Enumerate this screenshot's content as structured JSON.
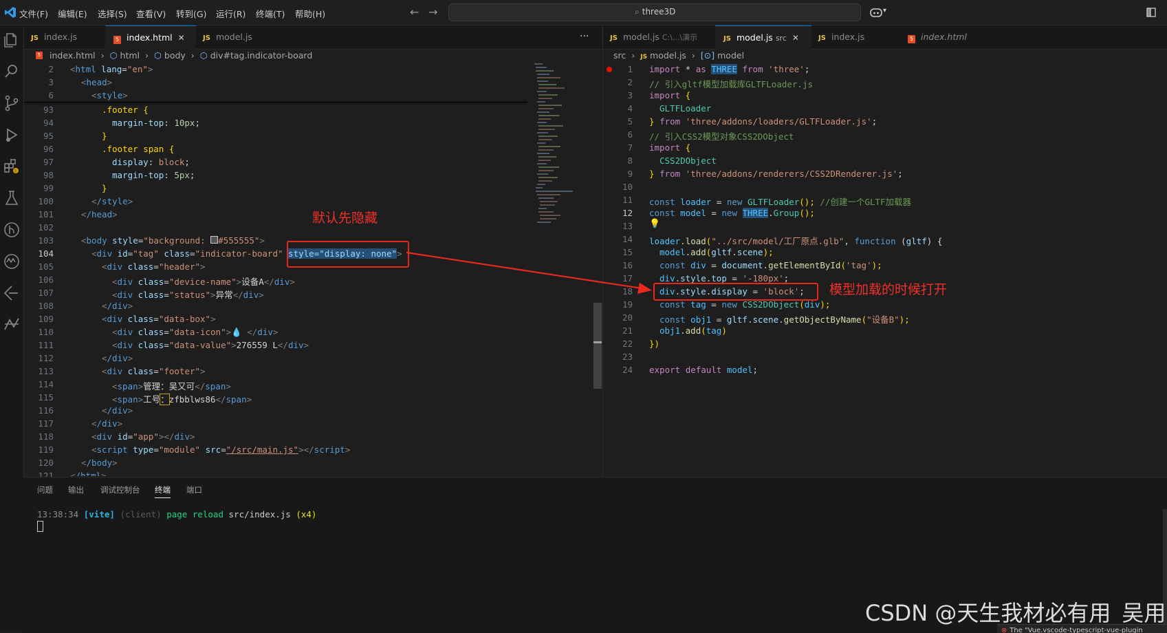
{
  "titlebar": {
    "menus": [
      "文件(F)",
      "编辑(E)",
      "选择(S)",
      "查看(V)",
      "转到(G)",
      "运行(R)",
      "终端(T)",
      "帮助(H)"
    ],
    "search": "three3D"
  },
  "activity_icons": [
    "explorer-icon",
    "search-icon",
    "source-control-icon",
    "run-debug-icon",
    "extensions-icon",
    "testing-icon",
    "git-lens-icon",
    "ai-assistant-icon",
    "remote-icon",
    "git-graph-icon"
  ],
  "left_tabs": [
    {
      "label": "index.js",
      "type": "js"
    },
    {
      "label": "index.html",
      "type": "html"
    },
    {
      "label": "model.js",
      "type": "js"
    }
  ],
  "right_tabs": [
    {
      "label": "model.js",
      "type": "js",
      "hint": "C:\\...\\演示"
    },
    {
      "label": "model.js",
      "type": "js",
      "hint": "src"
    },
    {
      "label": "index.js",
      "type": "js"
    },
    {
      "label": "index.html",
      "type": "html"
    }
  ],
  "left_breadcrumb": [
    "index.html",
    "html",
    "body",
    "div#tag.indicator-board"
  ],
  "right_breadcrumb": [
    "src",
    "model.js",
    "model"
  ],
  "left_editor": {
    "line_numbers": [
      "2",
      "3",
      "6",
      "93",
      "94",
      "95",
      "96",
      "97",
      "98",
      "99",
      "100",
      "101",
      "102",
      "103",
      "104",
      "105",
      "106",
      "107",
      "108",
      "109",
      "110",
      "111",
      "112",
      "113",
      "114",
      "115",
      "116",
      "117",
      "118",
      "119",
      "120",
      "121"
    ],
    "current_line": "104",
    "lines": {
      "l2_tag": "html",
      "l2_attr": "lang",
      "l2_val": "\"en\"",
      "l3_tag": "head",
      "l6_tag": "style",
      "l93": ".footer {",
      "l94_prop": "margin-top",
      "l94_val": "10px",
      "l95": "}",
      "l96": ".footer span {",
      "l97_prop": "display",
      "l97_val": "block",
      "l98_prop": "margin-top",
      "l98_val": "5px",
      "l99": "}",
      "l100_tag": "/style",
      "l101_tag": "/head",
      "l103_tag": "body",
      "l103_attr": "style",
      "l103_val": "\"background:",
      "l103_color": "#555555\"",
      "l104_tag": "div",
      "l104_a1": "id",
      "l104_v1": "\"tag\"",
      "l104_a2": "class",
      "l104_v2": "\"indicator-board\"",
      "l104_sel": "style=\"display: none\"",
      "l105_tag": "div",
      "l105_attr": "class",
      "l105_val": "\"header\"",
      "l106_val": "\"device-name\"",
      "l106_text": "设备A",
      "l107_val": "\"status\"",
      "l107_text": "异常",
      "l108_tag": "/div",
      "l109_val": "\"data-box\"",
      "l110_val": "\"data-icon\"",
      "l110_text": "💧 ",
      "l111_val": "\"data-value\"",
      "l111_text": "276559 L",
      "l112_tag": "/div",
      "l113_val": "\"footer\"",
      "l114_text": "管理：吴又可",
      "l115_text_a": "工号",
      "l115_text_b": "：",
      "l115_text_c": "zfbblws86",
      "l116_tag": "/div",
      "l117_tag": "/div",
      "l118_attr": "id",
      "l118_val": "\"app\"",
      "l119_a1": "type",
      "l119_v1": "\"module\"",
      "l119_a2": "src",
      "l119_v2": "\"/src/main.js\"",
      "l120_tag": "/body",
      "l121_tag": "/html"
    }
  },
  "right_editor": {
    "line_numbers": [
      "1",
      "2",
      "3",
      "4",
      "5",
      "6",
      "7",
      "8",
      "9",
      "10",
      "11",
      "12",
      "13",
      "14",
      "15",
      "16",
      "17",
      "18",
      "19",
      "20",
      "21",
      "22",
      "23",
      "24"
    ],
    "current_line": "12",
    "lines": {
      "r1": [
        "import",
        " * ",
        "as",
        " ",
        "THREE",
        " ",
        "from",
        " ",
        "'three'",
        ";"
      ],
      "r2": "// 引入gltf模型加载库GLTFLoader.js",
      "r3": [
        "import",
        " {"
      ],
      "r4": "GLTFLoader",
      "r5": [
        "} ",
        "from",
        " ",
        "'three/addons/loaders/GLTFLoader.js'",
        ";"
      ],
      "r6": "// 引入CSS2模型对象CSS2DObject",
      "r7": [
        "import",
        " {"
      ],
      "r8": "CSS2DObject",
      "r9": [
        "} ",
        "from",
        " ",
        "'three/addons/renderers/CSS2DRenderer.js'",
        ";"
      ],
      "r11": [
        "const",
        " ",
        "loader",
        " = ",
        "new",
        " ",
        "GLTFLoader",
        "(); ",
        "//创建一个GLTF加载器"
      ],
      "r12": [
        "const",
        " ",
        "model",
        " = ",
        "new",
        " ",
        "THREE",
        ".",
        "Group",
        "();"
      ],
      "r14": [
        "loader",
        ".",
        "load",
        "(",
        "\"../src/model/工厂原点.glb\"",
        ", ",
        "function",
        " (",
        "gltf",
        ") {"
      ],
      "r15": [
        "model",
        ".",
        "add",
        "(",
        "gltf",
        ".",
        "scene",
        ");"
      ],
      "r16": [
        "const",
        " ",
        "div",
        " = ",
        "document",
        ".",
        "getElementById",
        "(",
        "'tag'",
        ");"
      ],
      "r17": [
        "div",
        ".",
        "style",
        ".",
        "top",
        " = ",
        "'-180px'",
        ";"
      ],
      "r18": [
        "div",
        ".",
        "style",
        ".",
        "display",
        " = ",
        "'block'",
        ";"
      ],
      "r19": [
        "const",
        " ",
        "tag",
        " = ",
        "new",
        " ",
        "CSS2DObject",
        "(",
        "div",
        ");"
      ],
      "r20": [
        "const",
        " ",
        "obj1",
        " = ",
        "gltf",
        ".",
        "scene",
        ".",
        "getObjectByName",
        "(",
        "\"设备B\"",
        ");"
      ],
      "r21": [
        "obj1",
        ".",
        "add",
        "(",
        "tag",
        ")"
      ],
      "r22": "})",
      "r24": [
        "export",
        " ",
        "default",
        " ",
        "model",
        ";"
      ]
    }
  },
  "annotations": {
    "left": "默认先隐藏",
    "right": "模型加载的时候打开"
  },
  "panel": {
    "tabs": [
      "问题",
      "输出",
      "调试控制台",
      "终端",
      "端口"
    ],
    "active_tab": "终端",
    "terminal": {
      "time": "13:38:34",
      "tag": "[vite]",
      "client": "(client)",
      "msg": "page reload",
      "path": "src/index.js",
      "count": "(x4)"
    }
  },
  "watermark": "CSDN @天生我材必有用_吴用",
  "notification": "The \"Vue.vscode-typescript-vue-plugin"
}
